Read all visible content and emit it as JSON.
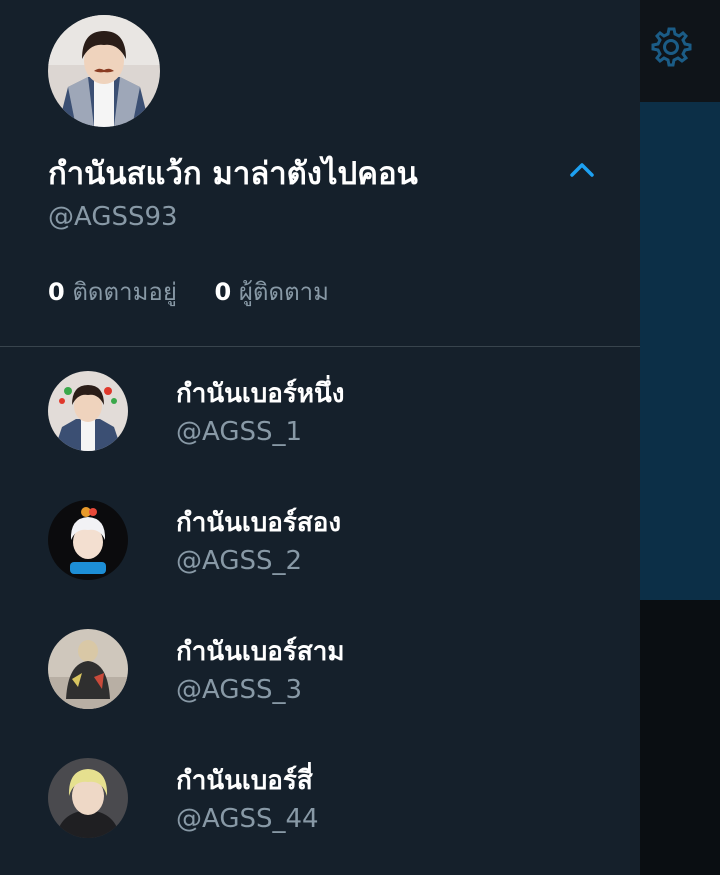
{
  "profile": {
    "display_name": "กำนันสแว้ก มาล่าตังไปคอน",
    "handle": "@AGSS93",
    "following_count": "0",
    "following_label": "ติดตามอยู่",
    "followers_count": "0",
    "followers_label": "ผู้ติดตาม"
  },
  "accounts": [
    {
      "name": "กำนันเบอร์หนึ่ง",
      "handle": "@AGSS_1"
    },
    {
      "name": "กำนันเบอร์สอง",
      "handle": "@AGSS_2"
    },
    {
      "name": "กำนันเบอร์สาม",
      "handle": "@AGSS_3"
    },
    {
      "name": "กำนันเบอร์สี่",
      "handle": "@AGSS_44"
    }
  ],
  "icons": {
    "settings": "gear-icon",
    "collapse": "chevron-up-icon"
  },
  "colors": {
    "drawer_bg": "#15202b",
    "accent": "#1da1f2",
    "secondary_text": "#8899a6",
    "primary_text": "#ffffff"
  }
}
